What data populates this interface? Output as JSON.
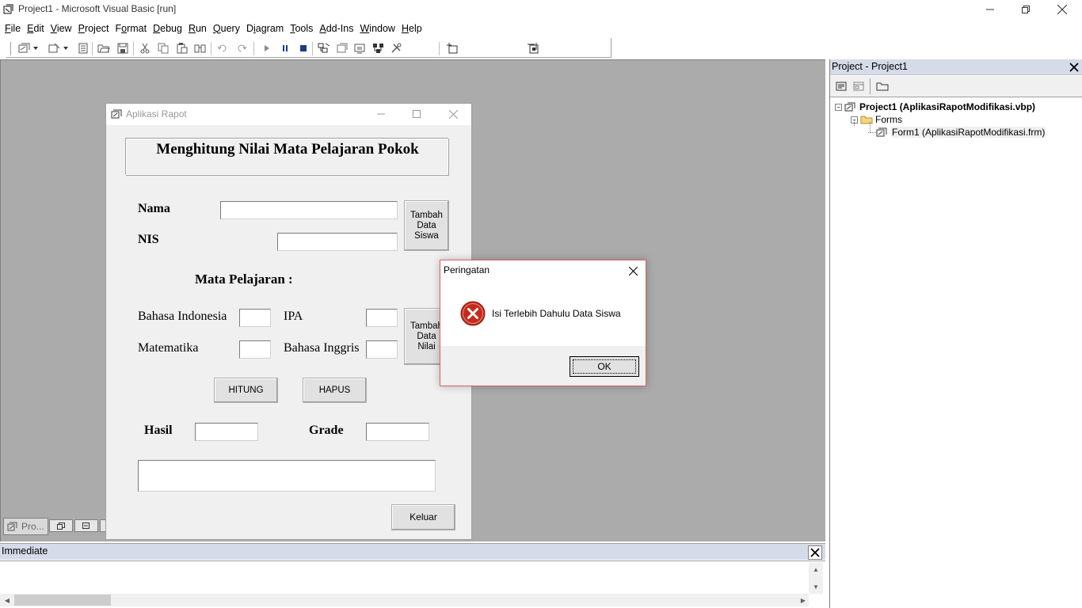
{
  "ide": {
    "title": "Project1 - Microsoft Visual Basic [run]",
    "menu": [
      {
        "ul": "F",
        "rest": "ile"
      },
      {
        "ul": "E",
        "rest": "dit"
      },
      {
        "ul": "V",
        "rest": "iew"
      },
      {
        "ul": "P",
        "rest": "roject"
      },
      {
        "ul": "",
        "pre": "F",
        "ul2": "o",
        "rest": "rmat"
      },
      {
        "ul": "D",
        "rest": "ebug"
      },
      {
        "ul": "R",
        "rest": "un"
      },
      {
        "ul": "Q",
        "rest": "uery"
      },
      {
        "pre": "D",
        "ul2": "i",
        "rest": "agram"
      },
      {
        "ul": "T",
        "rest": "ools"
      },
      {
        "ul": "A",
        "rest": "dd-Ins"
      },
      {
        "ul": "W",
        "rest": "indow"
      },
      {
        "ul": "H",
        "rest": "elp"
      }
    ]
  },
  "form": {
    "title": "Aplikasi Rapot",
    "heading": "Menghitung Nilai Mata Pelajaran Pokok",
    "label_nama": "Nama",
    "label_nis": "NIS",
    "btn_tambah_siswa": "Tambah Data Siswa",
    "label_mapel": "Mata Pelajaran :",
    "label_bindo": "Bahasa Indonesia",
    "label_ipa": "IPA",
    "label_mtk": "Matematika",
    "label_bing": "Bahasa Inggris",
    "btn_tambah_nilai": "Tambah Data Nilai",
    "btn_hitung": "HITUNG",
    "btn_hapus": "HAPUS",
    "label_hasil": "Hasil",
    "label_grade": "Grade",
    "btn_keluar": "Keluar"
  },
  "minimized": {
    "label": "Pro..."
  },
  "project_explorer": {
    "title": "Project - Project1",
    "root": "Project1 (AplikasiRapotModifikasi.vbp)",
    "folder": "Forms",
    "item": "Form1 (AplikasiRapotModifikasi.frm)"
  },
  "immediate": {
    "title": "Immediate"
  },
  "msgbox": {
    "title": "Peringatan",
    "message": "Isi Terlebih Dahulu Data Siswa",
    "ok": "OK",
    "icon": "error-icon"
  },
  "colors": {
    "mdi_bg": "#ababab",
    "panel_header": "#d6dbe9",
    "error_red": "#c42b1c"
  }
}
